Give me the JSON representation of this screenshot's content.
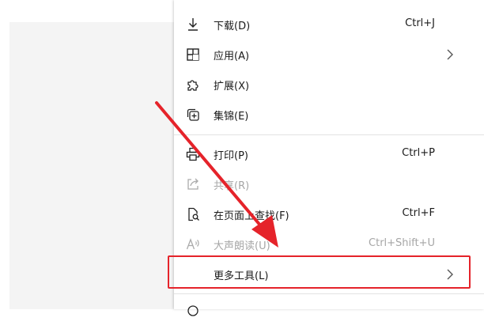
{
  "menu": {
    "items": [
      {
        "label": "下载(D)",
        "shortcut": "Ctrl+J",
        "icon": "download-icon"
      },
      {
        "label": "应用(A)",
        "shortcut": "",
        "icon": "apps-icon",
        "submenu": true
      },
      {
        "label": "扩展(X)",
        "shortcut": "",
        "icon": "extensions-icon"
      },
      {
        "label": "集锦(E)",
        "shortcut": "",
        "icon": "collections-icon"
      },
      {
        "label": "打印(P)",
        "shortcut": "Ctrl+P",
        "icon": "print-icon"
      },
      {
        "label": "共享(R)",
        "shortcut": "",
        "icon": "share-icon",
        "disabled": true
      },
      {
        "label": "在页面上查找(F)",
        "shortcut": "Ctrl+F",
        "icon": "find-on-page-icon"
      },
      {
        "label": "大声朗读(U)",
        "shortcut": "Ctrl+Shift+U",
        "icon": "read-aloud-icon",
        "disabled": true
      },
      {
        "label": "更多工具(L)",
        "shortcut": "",
        "icon": "",
        "submenu": true
      }
    ]
  },
  "colors": {
    "highlight": "#e5232a",
    "arrow": "#e5232a",
    "disabled_text": "#a6a6a6"
  }
}
